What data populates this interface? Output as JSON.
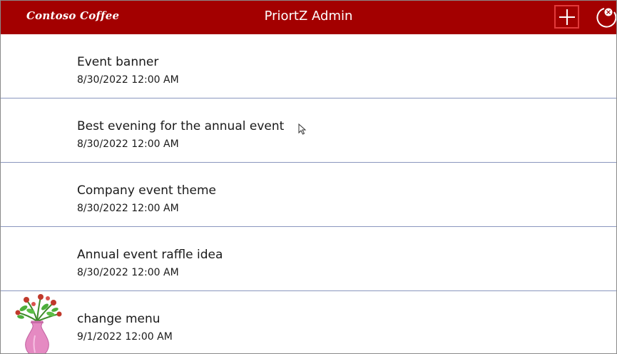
{
  "header": {
    "logo_text": "Contoso Coffee",
    "title": "PriortZ Admin",
    "add_icon": "plus-icon",
    "refresh_icon": "refresh-icon",
    "background_color": "#a30000"
  },
  "items": [
    {
      "title": "Event banner",
      "date": "8/30/2022 12:00 AM"
    },
    {
      "title": "Best evening for the annual event",
      "date": "8/30/2022 12:00 AM"
    },
    {
      "title": "Company event theme",
      "date": "8/30/2022 12:00 AM"
    },
    {
      "title": "Annual event raffle idea",
      "date": "8/30/2022 12:00 AM"
    },
    {
      "title": "change menu",
      "date": "9/1/2022 12:00 AM",
      "image": "flower-vase-thumbnail"
    }
  ]
}
